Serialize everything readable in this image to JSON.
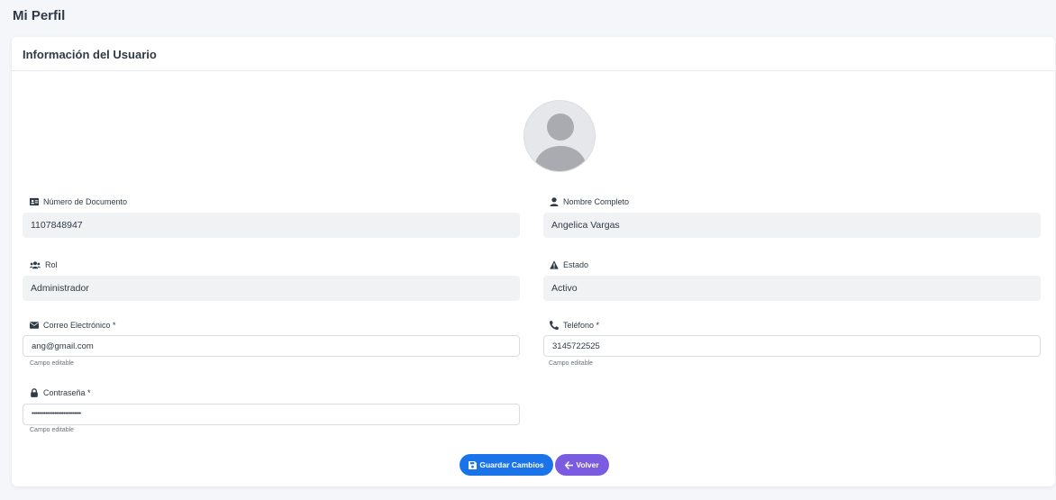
{
  "page": {
    "title": "Mi Perfil"
  },
  "card": {
    "title": "Información del Usuario"
  },
  "fields": {
    "documento": {
      "label": "Número de Documento",
      "value": "1107848947"
    },
    "nombre": {
      "label": "Nombre Completo",
      "value": "Angelica Vargas"
    },
    "rol": {
      "label": "Rol",
      "value": "Administrador"
    },
    "estado": {
      "label": "Estado",
      "value": "Activo"
    },
    "correo": {
      "label": "Correo Electrónico *",
      "value": "ang@gmail.com",
      "help": "Campo editable"
    },
    "telefono": {
      "label": "Teléfono *",
      "value": "3145722525",
      "help": "Campo editable"
    },
    "contrasena": {
      "label": "Contraseña *",
      "value": "••••••••••••••••••••••••••••",
      "help": "Campo editable"
    }
  },
  "buttons": {
    "save": "Guardar Cambios",
    "back": "Volver"
  },
  "colors": {
    "primary": "#1a73e8",
    "secondary": "#7b5be0",
    "readonly_bg": "#f1f2f4"
  },
  "icons": {
    "documento": "id-card-icon",
    "nombre": "user-icon",
    "rol": "users-icon",
    "estado": "warning-triangle-icon",
    "correo": "envelope-icon",
    "telefono": "phone-icon",
    "contrasena": "lock-icon",
    "save": "floppy-disk-icon",
    "back": "arrow-left-icon"
  }
}
